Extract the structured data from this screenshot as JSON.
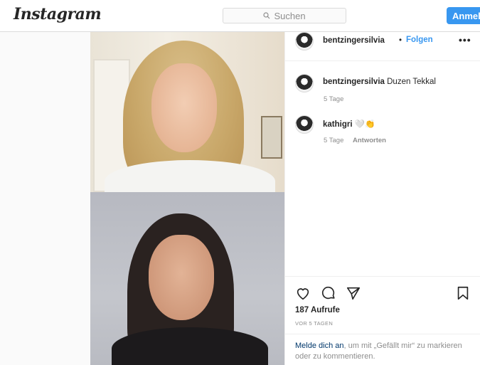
{
  "topbar": {
    "logo": "Instagram",
    "search_placeholder": "Suchen",
    "login_label": "Anmeld"
  },
  "post": {
    "author": "bentzingersilvia",
    "separator": "•",
    "follow_label": "Folgen",
    "more_label": "•••"
  },
  "comments": [
    {
      "user": "bentzingersilvia",
      "text": "Duzen Tekkal",
      "age": "5 Tage"
    },
    {
      "user": "kathigri",
      "text": "🤍👏",
      "age": "5 Tage",
      "reply_label": "Antworten"
    }
  ],
  "stats": {
    "views": "187 Aufrufe",
    "posted": "VOR 5 TAGEN"
  },
  "login_prompt": {
    "link": "Melde dich an",
    "rest": ", um mit „Gefällt mir“ zu markieren oder zu kommentieren."
  },
  "icons": [
    "search-icon",
    "heart-icon",
    "comment-icon",
    "share-icon",
    "bookmark-icon"
  ],
  "colors": {
    "accent": "#3897f0",
    "text": "#262626",
    "muted": "#8e8e8e",
    "link": "#00376b"
  }
}
